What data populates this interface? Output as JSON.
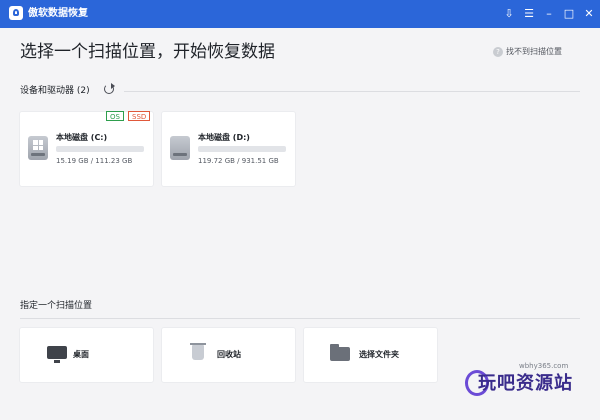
{
  "app": {
    "title": "傲软数据恢复",
    "window_controls": [
      "minimize-to-tray",
      "menu",
      "minimize",
      "maximize",
      "close"
    ]
  },
  "header": {
    "title": "选择一个扫描位置，开始恢复数据",
    "help_link": "找不到扫描位置"
  },
  "devices": {
    "section_title": "设备和驱动器 (2)",
    "drives": [
      {
        "name": "本地磁盘 (C:)",
        "size_text": "15.19 GB / 111.23 GB",
        "used_fraction": 0.137,
        "tags": [
          {
            "label": "OS",
            "color": "#2e9e4d"
          },
          {
            "label": "SSD",
            "color": "#e0583a"
          }
        ],
        "icon": "windows-disk-icon"
      },
      {
        "name": "本地磁盘 (D:)",
        "size_text": "119.72 GB / 931.51 GB",
        "used_fraction": 0.129,
        "tags": [],
        "icon": "disk-icon"
      }
    ]
  },
  "locations": {
    "section_title": "指定一个扫描位置",
    "items": [
      {
        "label": "桌面",
        "icon": "monitor-icon"
      },
      {
        "label": "回收站",
        "icon": "recycle-bin-icon"
      },
      {
        "label": "选择文件夹",
        "icon": "folder-icon"
      }
    ]
  },
  "watermark": {
    "url": "wbhy365.com",
    "brand": "玩吧资源站"
  },
  "colors": {
    "titlebar": "#2b66d9",
    "progress": "#3d8ae6",
    "background": "#f4f4f6"
  }
}
